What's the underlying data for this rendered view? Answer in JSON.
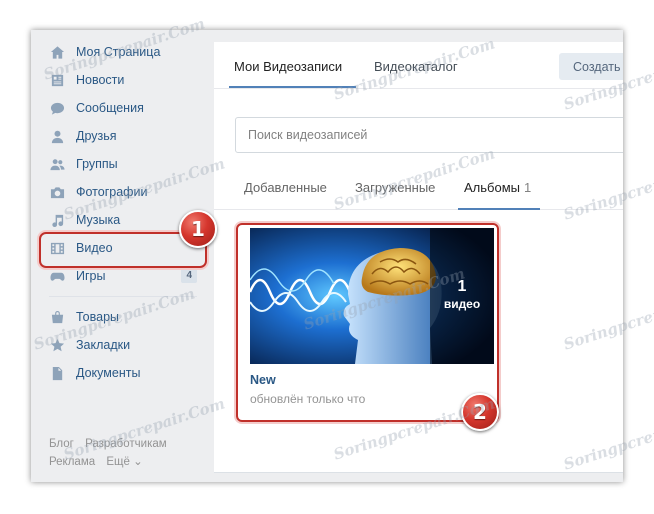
{
  "sidebar": {
    "items": [
      {
        "label": "Моя Страница",
        "icon": "home-icon"
      },
      {
        "label": "Новости",
        "icon": "news-icon"
      },
      {
        "label": "Сообщения",
        "icon": "messages-icon"
      },
      {
        "label": "Друзья",
        "icon": "friends-icon"
      },
      {
        "label": "Группы",
        "icon": "groups-icon"
      },
      {
        "label": "Фотографии",
        "icon": "camera-icon"
      },
      {
        "label": "Музыка",
        "icon": "music-icon"
      },
      {
        "label": "Видео",
        "icon": "video-icon"
      },
      {
        "label": "Игры",
        "icon": "games-icon",
        "count": "4"
      },
      {
        "label": "Товары",
        "icon": "goods-icon"
      },
      {
        "label": "Закладки",
        "icon": "star-icon"
      },
      {
        "label": "Документы",
        "icon": "document-icon"
      }
    ],
    "footer": {
      "row1": [
        "Блог",
        "Разработчикам"
      ],
      "row2": [
        "Реклама",
        "Ещё ⌄"
      ]
    }
  },
  "header": {
    "tabs": [
      "Мои Видеозаписи",
      "Видеокаталог"
    ],
    "create_label": "Создать"
  },
  "search": {
    "placeholder": "Поиск видеозаписей"
  },
  "subtabs": {
    "items": [
      "Добавленные",
      "Загруженные",
      "Альбомы"
    ],
    "albums_count": "1"
  },
  "album": {
    "count_number": "1",
    "count_word": "видео",
    "title": "New",
    "subtitle": "обновлён только что"
  },
  "badges": {
    "first": "1",
    "second": "2"
  },
  "watermark": "Soringpcrepair.Com",
  "colors": {
    "link": "#2a5885",
    "accent": "#5181b8",
    "highlight": "#c0302a"
  }
}
